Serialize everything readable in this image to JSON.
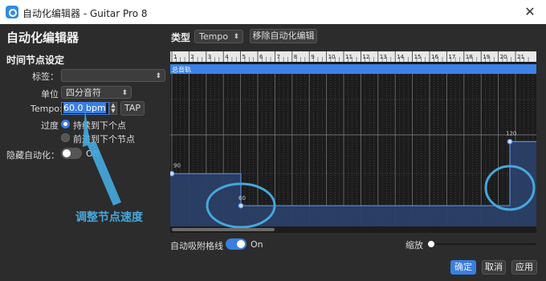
{
  "window": {
    "title": "自动化编辑器 - Guitar Pro 8",
    "close": "✕"
  },
  "left": {
    "heading": "自动化编辑器",
    "section": "时间节点设定",
    "label_field": {
      "label": "标签：",
      "value": ""
    },
    "unit": {
      "label": "单位",
      "value": "四分音符"
    },
    "tempo": {
      "label": "Tempo:",
      "value": "60.0 bpm",
      "tap": "TAP"
    },
    "transition": {
      "label": "过度",
      "options": [
        {
          "label": "持续到下个点",
          "selected": true
        },
        {
          "label": "前进到下个节点",
          "selected": false
        }
      ]
    },
    "hide_automation": {
      "label": "隐藏自动化：",
      "state": "Off"
    },
    "annotation": "调整节点速度"
  },
  "toolbar": {
    "type_label": "类型",
    "type_value": "Tempo",
    "remove_button": "移除自动化编辑"
  },
  "editor": {
    "ruler_numbers": [
      "1",
      "2",
      "3",
      "4",
      "5",
      "6",
      "7",
      "8",
      "9",
      "10",
      "11",
      "12",
      "13",
      "14",
      "15",
      "16",
      "17",
      "18",
      "19",
      "20",
      "21"
    ],
    "track_name": "总音轨",
    "points": [
      {
        "label": "90",
        "value": 90
      },
      {
        "label": "60",
        "value": 60
      },
      {
        "label": "120",
        "value": 120
      }
    ]
  },
  "snap": {
    "label": "自动吸附格线",
    "state": "On"
  },
  "zoom": {
    "label": "缩放"
  },
  "buttons": {
    "ok": "确定",
    "cancel": "取消",
    "apply": "应用"
  },
  "colors": {
    "accent": "#3a7ee0",
    "annotation": "#45a8dd",
    "track_bar": "#3c82e8",
    "fill": "#2b3f66"
  }
}
